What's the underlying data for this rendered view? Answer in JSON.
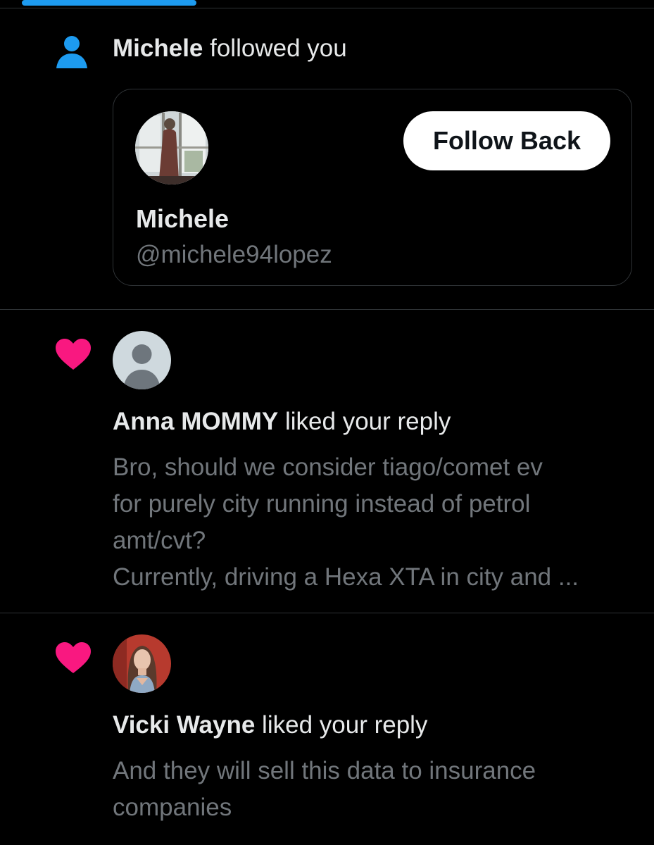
{
  "colors": {
    "background": "#000000",
    "accent": "#1d9bf0",
    "like": "#f91880",
    "divider": "#2f3336",
    "primary_text": "#e7e9ea",
    "secondary_text": "#71767b"
  },
  "notifications": [
    {
      "type": "follow",
      "icon": "person-icon",
      "actor": "Michele",
      "action": " followed you",
      "card": {
        "name": "Michele",
        "handle": "@michele94lopez",
        "button_label": "Follow Back"
      }
    },
    {
      "type": "like",
      "icon": "heart-icon",
      "actor": "Anna MOMMY",
      "action": " liked your reply",
      "avatar": "default-avatar",
      "text_lines": [
        "Bro, should we consider tiago/comet ev",
        "for purely city running instead of petrol",
        "amt/cvt?",
        "Currently, driving a Hexa XTA in city and ..."
      ]
    },
    {
      "type": "like",
      "icon": "heart-icon",
      "actor": "Vicki Wayne",
      "action": " liked your reply",
      "avatar": "photo-avatar",
      "text_lines": [
        "And they will sell this data to insurance",
        "companies"
      ]
    }
  ]
}
